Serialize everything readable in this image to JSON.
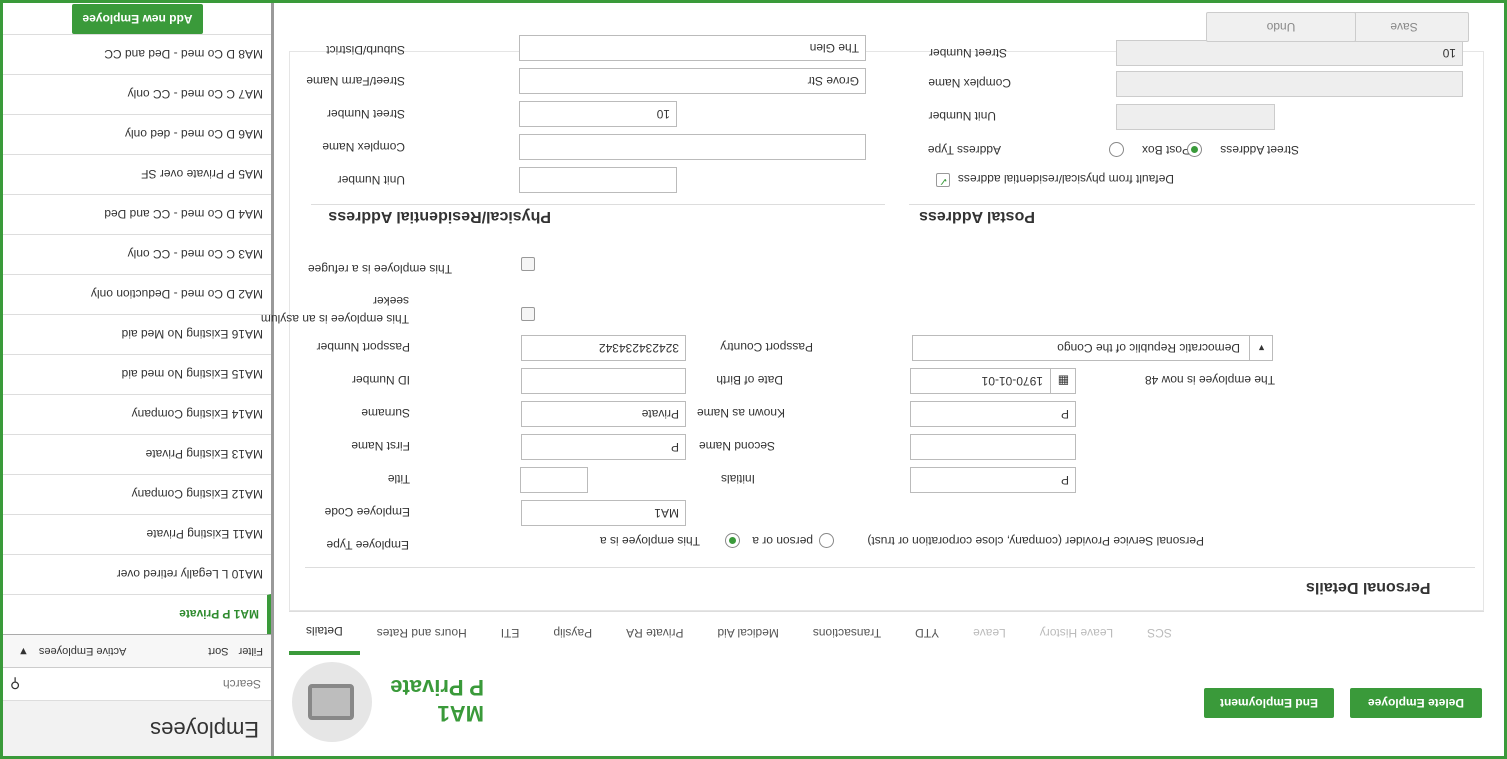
{
  "sidebar": {
    "title": "Employees",
    "search_placeholder": "Search",
    "filter_label": "Filter",
    "sort_label": "Sort",
    "filter_value": "Active Employees",
    "items": [
      {
        "label": "MA1 P Private",
        "active": true
      },
      {
        "label": "MA10 L Legally retired over"
      },
      {
        "label": "MA11 Existing Private"
      },
      {
        "label": "MA12 Existing Company"
      },
      {
        "label": "MA13 Existing Private"
      },
      {
        "label": "MA14 Existing Company"
      },
      {
        "label": "MA15 Existing No med aid"
      },
      {
        "label": "MA16 Existing No Med aid"
      },
      {
        "label": "MA2 D Co med - Deduction only"
      },
      {
        "label": "MA3 C Co med - CC only"
      },
      {
        "label": "MA4 D Co med - CC and Ded"
      },
      {
        "label": "MA5 P Private over SF"
      },
      {
        "label": "MA6 D Co med - ded only"
      },
      {
        "label": "MA7 C Co med - CC only"
      },
      {
        "label": "MA8 D Co med - Ded and CC"
      }
    ],
    "add_button": "Add new Employee"
  },
  "header": {
    "code": "MA1",
    "name": "P Private",
    "delete_button": "Delete Employee",
    "end_button": "End Employment"
  },
  "toolbar": {
    "undo": "Undo",
    "save": "Save"
  },
  "tabs": [
    {
      "label": "Details",
      "state": "active"
    },
    {
      "label": "Hours and Rates"
    },
    {
      "label": "ETI"
    },
    {
      "label": "Payslip"
    },
    {
      "label": "Private RA"
    },
    {
      "label": "Medical Aid"
    },
    {
      "label": "Transactions"
    },
    {
      "label": "YTD"
    },
    {
      "label": "Leave",
      "state": "disabled"
    },
    {
      "label": "Leave History",
      "state": "disabled"
    },
    {
      "label": "SCS",
      "state": "disabled"
    }
  ],
  "personal": {
    "section_title": "Personal Details",
    "employee_type_label": "Employee Type",
    "employee_type_prefix": "This employee is a",
    "employee_type_opt1": "person or a",
    "employee_type_opt2": "Personal Service Provider (company, close corporation or trust)",
    "employee_code_label": "Employee Code",
    "employee_code": "MA1",
    "title_label": "Title",
    "title": "",
    "initials_label": "Initials",
    "initials": "P",
    "first_name_label": "First Name",
    "first_name": "P",
    "second_name_label": "Second Name",
    "second_name": "",
    "surname_label": "Surname",
    "surname": "Private",
    "known_as_label": "Known as Name",
    "known_as": "P",
    "id_number_label": "ID Number",
    "id_number": "",
    "dob_label": "Date of Birth",
    "dob": "1970-01-01",
    "age_text": "The employee is now 48",
    "passport_number_label": "Passport Number",
    "passport_number": "324234234342",
    "passport_country_label": "Passport Country",
    "passport_country": "Democratic Republic of the Congo",
    "asylum_label": "This employee is an asylum seeker",
    "refugee_label": "This employee is a refugee"
  },
  "physical": {
    "section_title": "Physical/Residential Address",
    "unit_number_label": "Unit Number",
    "unit_number": "",
    "complex_name_label": "Complex Name",
    "complex_name": "",
    "street_number_label": "Street Number",
    "street_number": "10",
    "street_name_label": "Street/Farm Name",
    "street_name": "Grove Str",
    "suburb_label": "Suburb/District",
    "suburb": "The Glen"
  },
  "postal": {
    "section_title": "Postal Address",
    "default_label": "Default from physical/residential address",
    "address_type_label": "Address Type",
    "post_box_label": "Post Box",
    "street_address_label": "Street Address",
    "unit_number_label": "Unit Number",
    "complex_name_label": "Complex Name",
    "street_number_label": "Street Number",
    "street_number": "10"
  },
  "colors": {
    "accent": "#3a9a3a"
  }
}
